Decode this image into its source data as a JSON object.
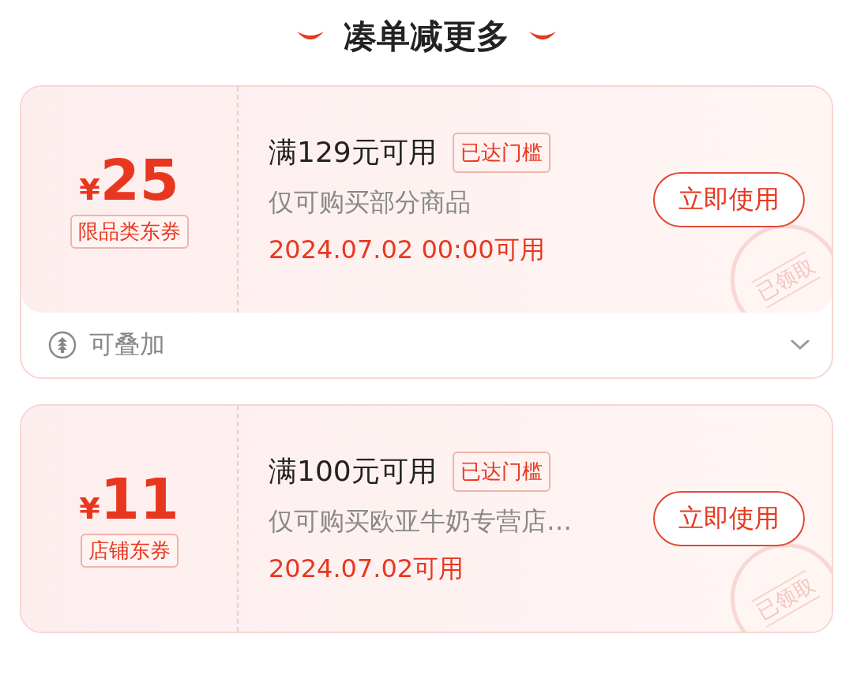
{
  "title": "凑单减更多",
  "coupons": [
    {
      "currency": "¥",
      "amount": "25",
      "type_label": "限品类东券",
      "threshold": "满129元可用",
      "badge": "已达门槛",
      "scope": "仅可购买部分商品",
      "valid": "2024.07.02 00:00可用",
      "button": "立即使用",
      "stamp": "已领取",
      "stackable": "可叠加"
    },
    {
      "currency": "¥",
      "amount": "11",
      "type_label": "店铺东券",
      "threshold": "满100元可用",
      "badge": "已达门槛",
      "scope": "仅可购买欧亚牛奶专营店…",
      "valid": "2024.07.02可用",
      "button": "立即使用",
      "stamp": "已领取"
    }
  ]
}
